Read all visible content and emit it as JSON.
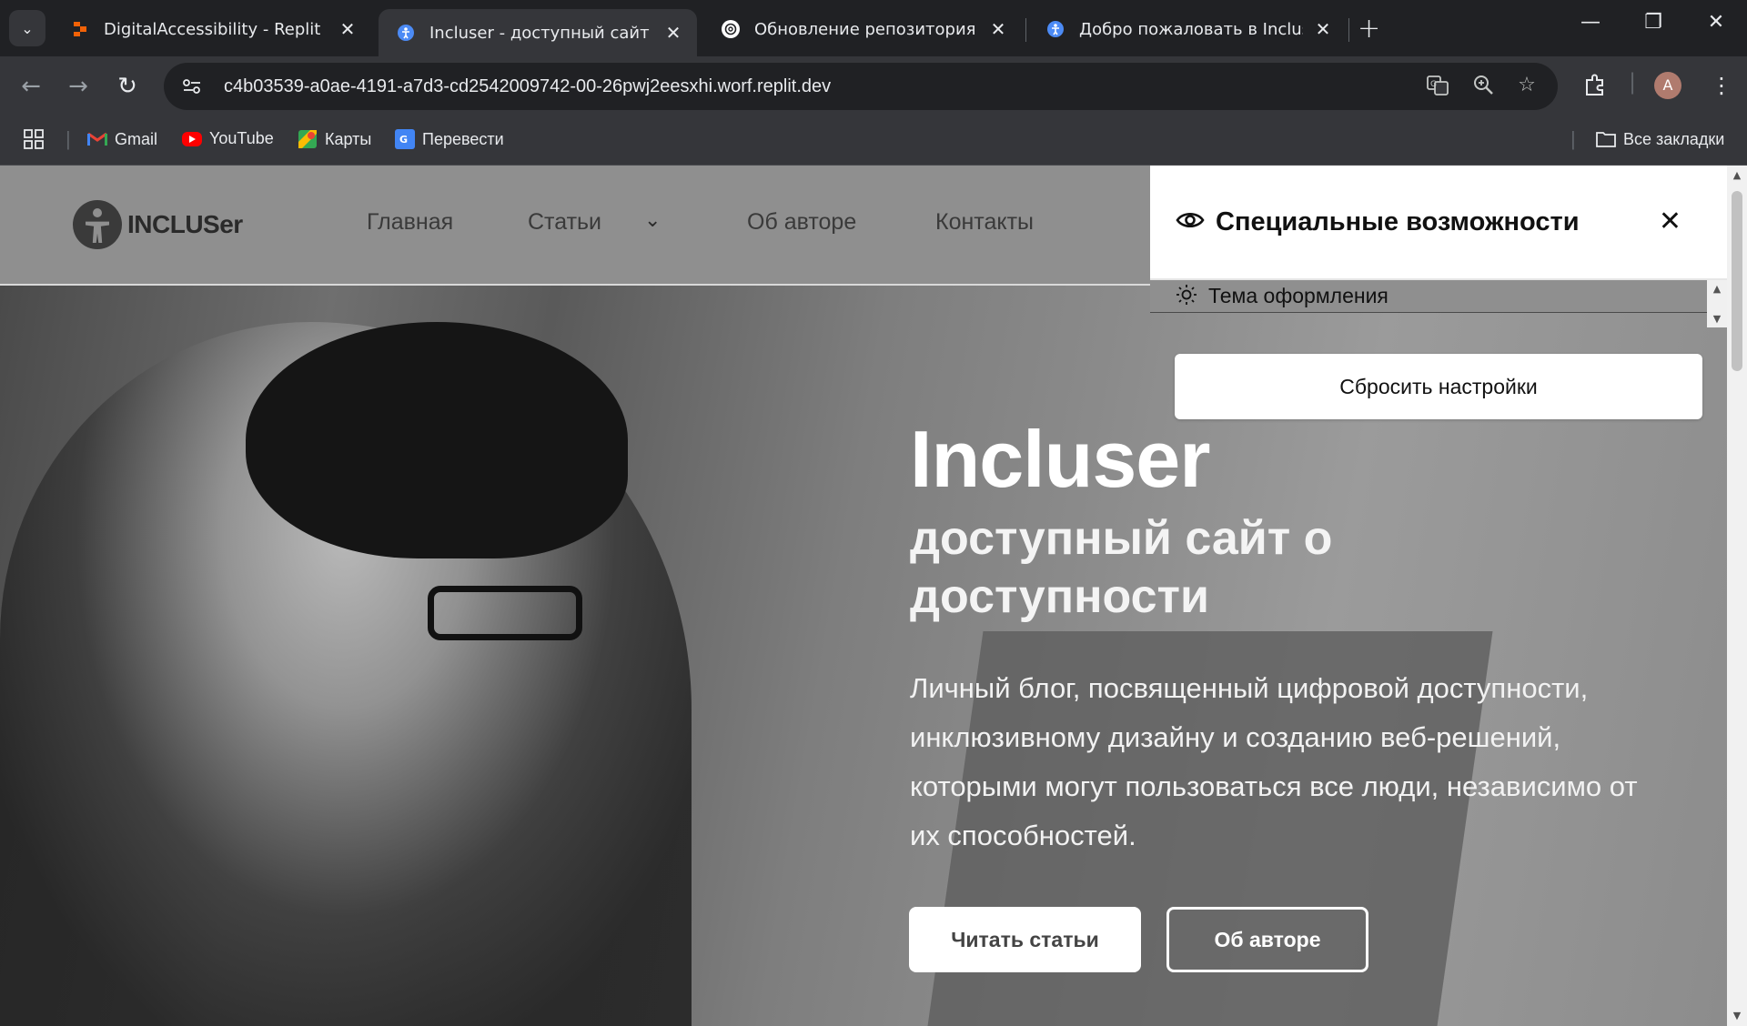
{
  "tabs": [
    {
      "title": "DigitalAccessibility - Replit",
      "active": false
    },
    {
      "title": "Incluser - доступный сайт о до",
      "active": true
    },
    {
      "title": "Обновление репозитория на Gi",
      "active": false
    },
    {
      "title": "Добро пожаловать в Incluser!",
      "active": false
    }
  ],
  "toolbar": {
    "url": "c4b03539-a0ae-4191-a7d3-cd2542009742-00-26pwj2eesxhi.worf.replit.dev",
    "avatar_letter": "A"
  },
  "bookmarks": {
    "items": [
      {
        "label": "Gmail",
        "icon": "gmail-icon"
      },
      {
        "label": "YouTube",
        "icon": "youtube-icon"
      },
      {
        "label": "Карты",
        "icon": "maps-icon"
      },
      {
        "label": "Перевести",
        "icon": "translate-icon"
      }
    ],
    "all_label": "Все закладки"
  },
  "site": {
    "logo": "INCLUSer",
    "nav": [
      "Главная",
      "Статьи",
      "Об авторе",
      "Контакты"
    ],
    "hero_title": "Incluser",
    "hero_subtitle": "доступный сайт о доступности",
    "hero_desc": "Личный блог, посвященный цифровой доступности, инклюзивному дизайну и созданию веб-решений, которыми могут пользоваться все люди, независимо от их способностей.",
    "btn_primary": "Читать статьи",
    "btn_secondary": "Об авторе"
  },
  "a11y_panel": {
    "title": "Специальные возможности",
    "theme_label": "Тема оформления",
    "reset_label": "Сбросить настройки"
  }
}
